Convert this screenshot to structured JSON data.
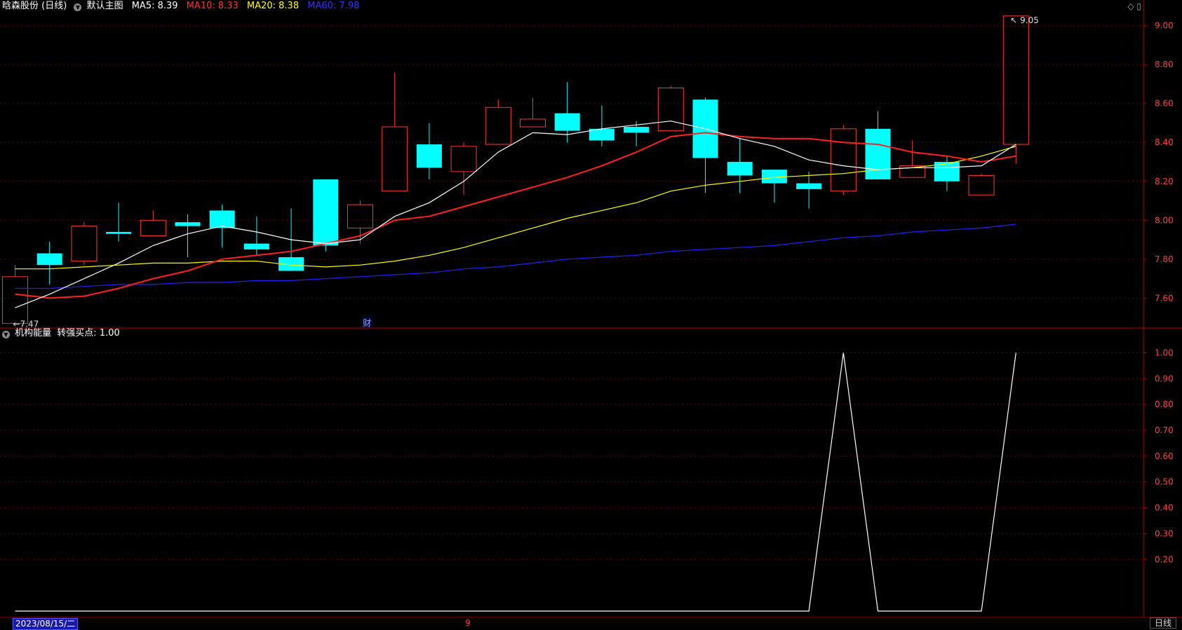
{
  "header": {
    "stock": "晗森股份 (日线)",
    "template": "默认主图",
    "ma5_label": "MA5: ",
    "ma5_value": "8.39",
    "ma10_label": "MA10: ",
    "ma10_value": "8.33",
    "ma20_label": "MA20: ",
    "ma20_value": "8.38",
    "ma60_label": "MA60: ",
    "ma60_value": "7.98"
  },
  "indicator": {
    "name": "机构能量",
    "label": "转强买点:",
    "value": "1.00"
  },
  "footer": {
    "date": "2023/08/15/二",
    "month_marker": "9",
    "period_tab": "日线"
  },
  "markers": {
    "fin": "财",
    "low_label": "7.47",
    "high_label": "9.05"
  },
  "colors": {
    "up": "#ff3232",
    "down": "#00ffff",
    "ma5": "#ffffff",
    "ma10": "#ff2020",
    "ma20": "#ffff00",
    "ma60": "#2020ff",
    "axis": "#b00000"
  },
  "chart_data": [
    {
      "type": "candlestick",
      "ylim": [
        7.45,
        9.06
      ],
      "yticks": [
        "9.00",
        "8.80",
        "8.60",
        "8.40",
        "8.20",
        "8.00",
        "7.80",
        "7.60"
      ],
      "candles": [
        {
          "o": 7.47,
          "h": 7.77,
          "l": 7.47,
          "c": 7.71
        },
        {
          "o": 7.83,
          "h": 7.89,
          "l": 7.67,
          "c": 7.77
        },
        {
          "o": 7.79,
          "h": 7.99,
          "l": 7.77,
          "c": 7.97
        },
        {
          "o": 7.94,
          "h": 8.09,
          "l": 7.89,
          "c": 7.93
        },
        {
          "o": 7.92,
          "h": 8.05,
          "l": 7.92,
          "c": 8.0
        },
        {
          "o": 7.99,
          "h": 8.03,
          "l": 7.81,
          "c": 7.97
        },
        {
          "o": 8.05,
          "h": 8.08,
          "l": 7.86,
          "c": 7.96
        },
        {
          "o": 7.88,
          "h": 8.02,
          "l": 7.82,
          "c": 7.85
        },
        {
          "o": 7.81,
          "h": 8.06,
          "l": 7.74,
          "c": 7.74
        },
        {
          "o": 8.21,
          "h": 8.21,
          "l": 7.84,
          "c": 7.87
        },
        {
          "o": 7.96,
          "h": 8.1,
          "l": 7.88,
          "c": 8.08
        },
        {
          "o": 8.15,
          "h": 8.76,
          "l": 8.15,
          "c": 8.48
        },
        {
          "o": 8.39,
          "h": 8.5,
          "l": 8.21,
          "c": 8.27
        },
        {
          "o": 8.25,
          "h": 8.4,
          "l": 8.13,
          "c": 8.38
        },
        {
          "o": 8.39,
          "h": 8.62,
          "l": 8.39,
          "c": 8.58
        },
        {
          "o": 8.48,
          "h": 8.63,
          "l": 8.48,
          "c": 8.52
        },
        {
          "o": 8.55,
          "h": 8.71,
          "l": 8.4,
          "c": 8.46
        },
        {
          "o": 8.47,
          "h": 8.59,
          "l": 8.38,
          "c": 8.41
        },
        {
          "o": 8.48,
          "h": 8.51,
          "l": 8.38,
          "c": 8.45
        },
        {
          "o": 8.46,
          "h": 8.69,
          "l": 8.46,
          "c": 8.68
        },
        {
          "o": 8.62,
          "h": 8.63,
          "l": 8.14,
          "c": 8.32
        },
        {
          "o": 8.3,
          "h": 8.42,
          "l": 8.14,
          "c": 8.23
        },
        {
          "o": 8.26,
          "h": 8.26,
          "l": 8.09,
          "c": 8.19
        },
        {
          "o": 8.19,
          "h": 8.25,
          "l": 8.06,
          "c": 8.16
        },
        {
          "o": 8.15,
          "h": 8.49,
          "l": 8.13,
          "c": 8.47
        },
        {
          "o": 8.47,
          "h": 8.56,
          "l": 8.21,
          "c": 8.21
        },
        {
          "o": 8.22,
          "h": 8.41,
          "l": 8.22,
          "c": 8.28
        },
        {
          "o": 8.3,
          "h": 8.33,
          "l": 8.15,
          "c": 8.2
        },
        {
          "o": 8.13,
          "h": 8.24,
          "l": 8.13,
          "c": 8.23
        },
        {
          "o": 8.39,
          "h": 9.05,
          "l": 8.29,
          "c": 9.05
        }
      ],
      "ma5": [
        7.55,
        7.62,
        7.7,
        7.78,
        7.87,
        7.93,
        7.97,
        7.94,
        7.9,
        7.88,
        7.9,
        8.02,
        8.09,
        8.2,
        8.35,
        8.45,
        8.44,
        8.47,
        8.49,
        8.51,
        8.47,
        8.42,
        8.38,
        8.31,
        8.28,
        8.26,
        8.27,
        8.27,
        8.28,
        8.39
      ],
      "ma10": [
        7.62,
        7.6,
        7.61,
        7.65,
        7.7,
        7.74,
        7.8,
        7.82,
        7.84,
        7.88,
        7.92,
        8.0,
        8.02,
        8.07,
        8.12,
        8.17,
        8.22,
        8.28,
        8.35,
        8.43,
        8.45,
        8.43,
        8.42,
        8.42,
        8.4,
        8.39,
        8.35,
        8.33,
        8.3,
        8.33
      ],
      "ma20": [
        7.75,
        7.75,
        7.76,
        7.77,
        7.78,
        7.78,
        7.79,
        7.79,
        7.77,
        7.76,
        7.77,
        7.79,
        7.82,
        7.86,
        7.91,
        7.96,
        8.01,
        8.05,
        8.09,
        8.15,
        8.18,
        8.2,
        8.22,
        8.23,
        8.24,
        8.26,
        8.27,
        8.29,
        8.33,
        8.38
      ],
      "ma60": [
        7.65,
        7.65,
        7.66,
        7.67,
        7.67,
        7.68,
        7.68,
        7.69,
        7.69,
        7.7,
        7.71,
        7.72,
        7.73,
        7.75,
        7.76,
        7.78,
        7.8,
        7.81,
        7.82,
        7.84,
        7.85,
        7.86,
        7.87,
        7.89,
        7.91,
        7.92,
        7.94,
        7.95,
        7.96,
        7.98
      ]
    },
    {
      "type": "line",
      "name": "转强买点",
      "ylim": [
        0,
        1.05
      ],
      "yticks": [
        "1.00",
        "0.90",
        "0.80",
        "0.70",
        "0.60",
        "0.50",
        "0.40",
        "0.30",
        "0.20"
      ],
      "values": [
        0,
        0,
        0,
        0,
        0,
        0,
        0,
        0,
        0,
        0,
        0,
        0,
        0,
        0,
        0,
        0,
        0,
        0,
        0,
        0,
        0,
        0,
        0,
        0,
        1,
        0,
        0,
        0,
        0,
        1
      ]
    }
  ]
}
